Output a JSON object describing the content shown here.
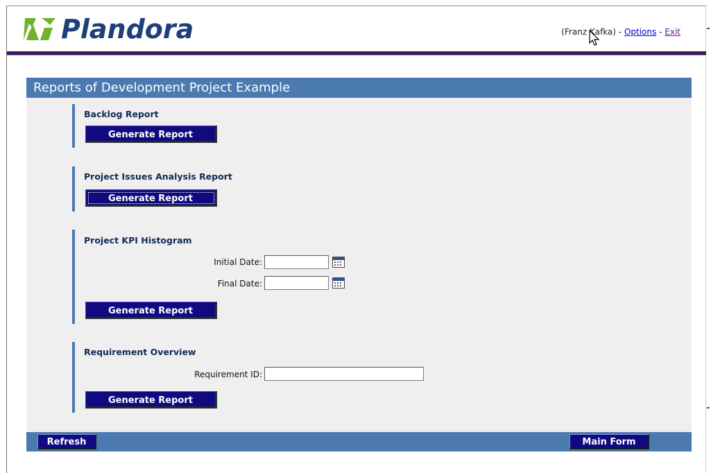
{
  "app": {
    "logo_text": "Plandora",
    "user_name": "(Franz Kafka)",
    "separator": "-",
    "options_link": "Options",
    "exit_link": "Exit"
  },
  "panel": {
    "title": "Reports of Development Project Example"
  },
  "sections": {
    "backlog": {
      "title": "Backlog Report",
      "button": "Generate Report"
    },
    "issues": {
      "title": "Project Issues Analysis Report",
      "button": "Generate Report"
    },
    "kpi": {
      "title": "Project KPI Histogram",
      "initial_label": "Initial Date:",
      "initial_value": "",
      "final_label": "Final Date:",
      "final_value": "",
      "button": "Generate Report"
    },
    "requirement": {
      "title": "Requirement Overview",
      "id_label": "Requirement ID:",
      "id_value": "",
      "button": "Generate Report"
    }
  },
  "bottom": {
    "refresh": "Refresh",
    "main_form": "Main Form"
  },
  "colors": {
    "title_bar": "#4a7ab0",
    "button": "#0f0a80",
    "header_rule": "#3c1a5c",
    "logo_green": "#6fb32b",
    "logo_text": "#1d3f7a"
  },
  "icons": [
    "plandora-logo-icon",
    "calendar-icon",
    "mouse-cursor-icon"
  ]
}
